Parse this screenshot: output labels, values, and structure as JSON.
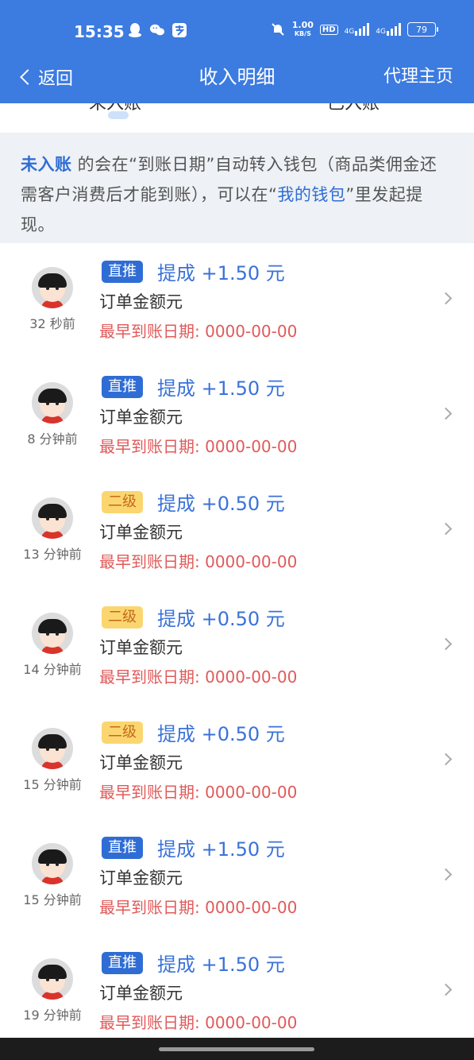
{
  "status_bar": {
    "time": "15:35",
    "icons_left": [
      "qq-icon",
      "wechat-icon",
      "alipay-icon"
    ],
    "net_speed_value": "1.00",
    "net_speed_unit": "KB/S",
    "hd_label": "HD",
    "signal_1": "4G",
    "signal_2": "4G",
    "battery": "79"
  },
  "nav": {
    "back_label": "返回",
    "title": "收入明细",
    "right_label": "代理主页"
  },
  "tabs": [
    {
      "label": "未入账"
    },
    {
      "label": "已入账"
    }
  ],
  "notice": {
    "part1": "未入账",
    "part2": " 的会在“到账日期”自动转入钱包（商品类佣金还需客户消费后才能到账），可以在“",
    "part3": "我的钱包",
    "part4": "”里发起提现。"
  },
  "records": [
    {
      "time_ago": "32 秒前",
      "tag": "直推",
      "tag_type": "direct",
      "amount": "提成 +1.50 元",
      "order": "订单金额元",
      "date": "最早到账日期: 0000-00-00"
    },
    {
      "time_ago": "8 分钟前",
      "tag": "直推",
      "tag_type": "direct",
      "amount": "提成 +1.50 元",
      "order": "订单金额元",
      "date": "最早到账日期: 0000-00-00"
    },
    {
      "time_ago": "13 分钟前",
      "tag": "二级",
      "tag_type": "second",
      "amount": "提成 +0.50 元",
      "order": "订单金额元",
      "date": "最早到账日期: 0000-00-00"
    },
    {
      "time_ago": "14 分钟前",
      "tag": "二级",
      "tag_type": "second",
      "amount": "提成 +0.50 元",
      "order": "订单金额元",
      "date": "最早到账日期: 0000-00-00"
    },
    {
      "time_ago": "15 分钟前",
      "tag": "二级",
      "tag_type": "second",
      "amount": "提成 +0.50 元",
      "order": "订单金额元",
      "date": "最早到账日期: 0000-00-00"
    },
    {
      "time_ago": "15 分钟前",
      "tag": "直推",
      "tag_type": "direct",
      "amount": "提成 +1.50 元",
      "order": "订单金额元",
      "date": "最早到账日期: 0000-00-00"
    },
    {
      "time_ago": "19 分钟前",
      "tag": "直推",
      "tag_type": "direct",
      "amount": "提成 +1.50 元",
      "order": "订单金额元",
      "date": "最早到账日期: 0000-00-00"
    }
  ],
  "colors": {
    "header": "#3c7be0",
    "accent": "#2f6dd5",
    "second_tag_bg": "#fbd670",
    "date_text": "#e05a5a"
  }
}
